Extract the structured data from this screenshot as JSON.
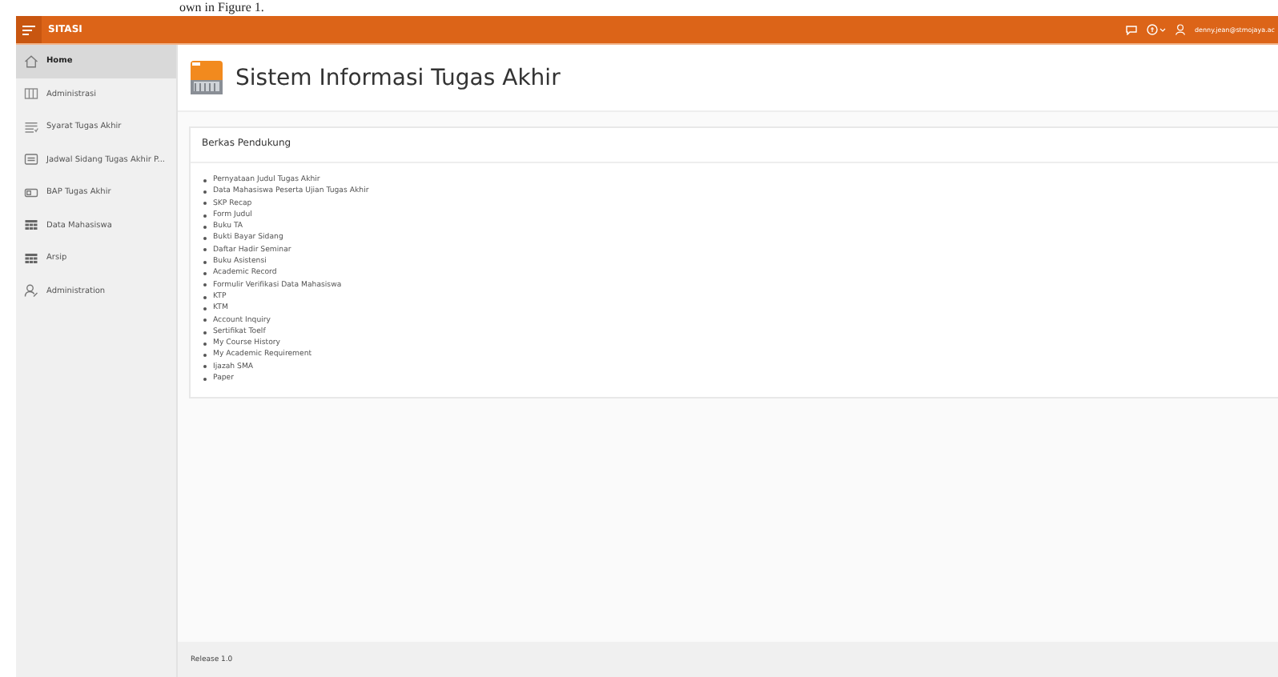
{
  "caption": "own in Figure 1.",
  "topbar": {
    "app_name": "SITASI",
    "user": "denny.jean@stmojaya.ac"
  },
  "sidebar": {
    "items": [
      {
        "label": "Home",
        "kind": "home",
        "selected": true
      },
      {
        "label": "Administrasi",
        "kind": "grid",
        "selected": false
      },
      {
        "label": "Syarat Tugas Akhir",
        "kind": "list",
        "selected": false
      },
      {
        "label": "Jadwal Sidang Tugas Akhir P...",
        "kind": "form",
        "selected": false
      },
      {
        "label": "BAP Tugas Akhir",
        "kind": "card",
        "selected": false
      },
      {
        "label": "Data Mahasiswa",
        "kind": "table",
        "selected": false
      },
      {
        "label": "Arsip",
        "kind": "table",
        "selected": false
      },
      {
        "label": "Administration",
        "kind": "user",
        "selected": false
      }
    ]
  },
  "header": {
    "title": "Sistem Informasi Tugas Akhir"
  },
  "card": {
    "title": "Berkas Pendukung",
    "items": [
      "Pernyataan Judul Tugas Akhir",
      "Data Mahasiswa Peserta Ujian Tugas Akhir",
      "SKP Recap",
      "Form Judul",
      "Buku TA",
      "Bukti Bayar Sidang",
      "Daftar Hadir Seminar",
      "Buku Asistensi",
      "Academic Record",
      "Formulir Verifikasi Data Mahasiswa",
      "KTP",
      "KTM",
      "Account Inquiry",
      "Sertifikat Toelf",
      "My Course History",
      "My Academic Requirement",
      "Ijazah SMA",
      "Paper"
    ]
  },
  "footer": {
    "text": "Release 1.0"
  }
}
